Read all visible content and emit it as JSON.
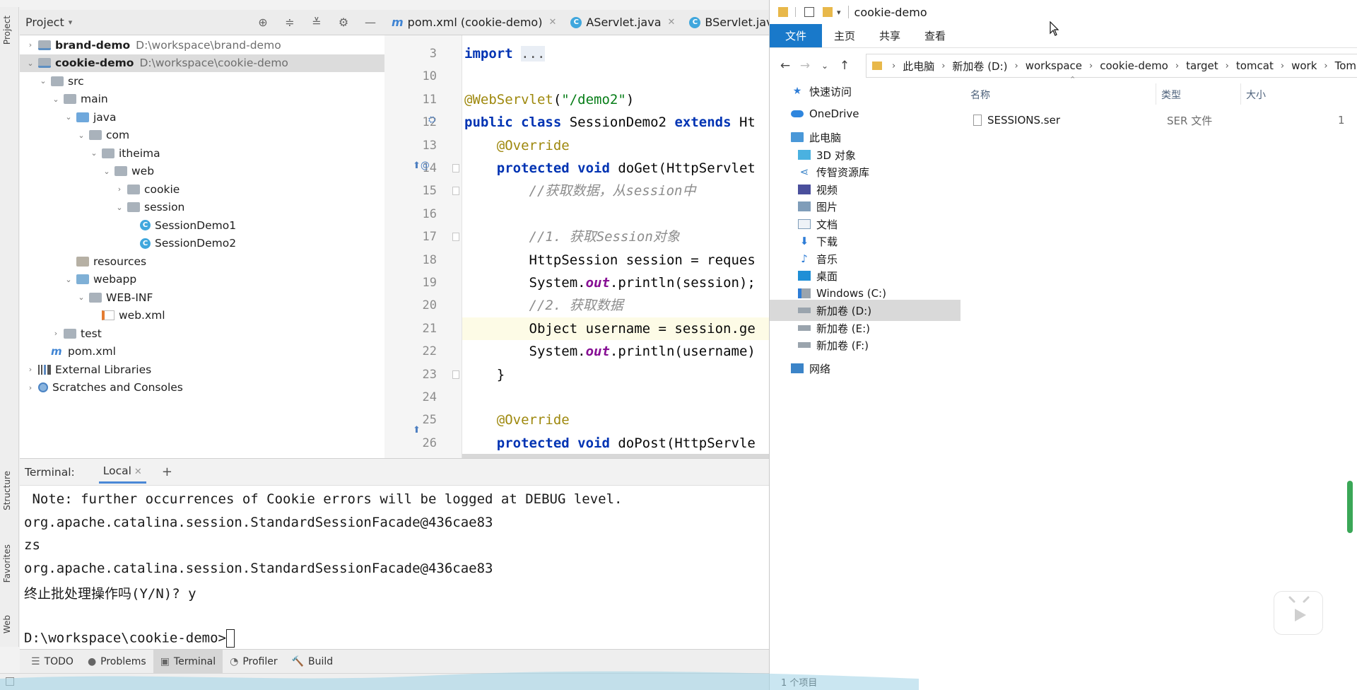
{
  "ide": {
    "side_labels": {
      "project": "Project",
      "structure": "Structure",
      "favorites": "Favorites",
      "web": "Web"
    },
    "project_title": "Project",
    "tree": [
      {
        "label": "brand-demo",
        "path": "D:\\workspace\\brand-demo",
        "bold": true,
        "depth": 0,
        "chevron": "›",
        "icon": "module"
      },
      {
        "label": "cookie-demo",
        "path": "D:\\workspace\\cookie-demo",
        "bold": true,
        "depth": 0,
        "chevron": "⌄",
        "icon": "module",
        "selected": true
      },
      {
        "label": "src",
        "depth": 1,
        "chevron": "⌄",
        "icon": "folder"
      },
      {
        "label": "main",
        "depth": 2,
        "chevron": "⌄",
        "icon": "folder"
      },
      {
        "label": "java",
        "depth": 3,
        "chevron": "⌄",
        "icon": "folder-src"
      },
      {
        "label": "com",
        "depth": 4,
        "chevron": "⌄",
        "icon": "folder"
      },
      {
        "label": "itheima",
        "depth": 5,
        "chevron": "⌄",
        "icon": "folder"
      },
      {
        "label": "web",
        "depth": 6,
        "chevron": "⌄",
        "icon": "folder"
      },
      {
        "label": "cookie",
        "depth": 7,
        "chevron": "›",
        "icon": "folder"
      },
      {
        "label": "session",
        "depth": 7,
        "chevron": "⌄",
        "icon": "folder"
      },
      {
        "label": "SessionDemo1",
        "depth": 8,
        "chevron": "",
        "icon": "cls"
      },
      {
        "label": "SessionDemo2",
        "depth": 8,
        "chevron": "",
        "icon": "cls"
      },
      {
        "label": "resources",
        "depth": 3,
        "chevron": "",
        "icon": "folder-res"
      },
      {
        "label": "webapp",
        "depth": 3,
        "chevron": "⌄",
        "icon": "folder-web"
      },
      {
        "label": "WEB-INF",
        "depth": 4,
        "chevron": "⌄",
        "icon": "folder"
      },
      {
        "label": "web.xml",
        "depth": 5,
        "chevron": "",
        "icon": "xml"
      },
      {
        "label": "test",
        "depth": 2,
        "chevron": "›",
        "icon": "folder"
      },
      {
        "label": "pom.xml",
        "depth": 1,
        "chevron": "",
        "icon": "maven"
      },
      {
        "label": "External Libraries",
        "depth": 0,
        "chevron": "›",
        "icon": "lib"
      },
      {
        "label": "Scratches and Consoles",
        "depth": 0,
        "chevron": "›",
        "icon": "scratch"
      }
    ],
    "editor_tabs": [
      {
        "label": "pom.xml (cookie-demo)",
        "icon": "maven"
      },
      {
        "label": "AServlet.java",
        "icon": "cls"
      },
      {
        "label": "BServlet.java",
        "icon": "cls"
      }
    ],
    "code_lines": [
      {
        "no": "3",
        "html": "<span class=\"kw\">import</span> <span class=\"fold-dots\">...</span>"
      },
      {
        "no": "10",
        "html": ""
      },
      {
        "no": "11",
        "html": "<span class=\"ann\">@WebServlet</span>(<span class=\"str\">\"/demo2\"</span>)"
      },
      {
        "no": "12",
        "html": "<span class=\"kw\">public class</span> SessionDemo2 <span class=\"kw\">extends</span> Ht"
      },
      {
        "no": "13",
        "html": "    <span class=\"ann\">@Override</span>"
      },
      {
        "no": "14",
        "html": "    <span class=\"kw\">protected void</span> doGet(HttpServlet"
      },
      {
        "no": "15",
        "html": "        <span class=\"cmt\">//获取数据，从session中</span>"
      },
      {
        "no": "16",
        "html": ""
      },
      {
        "no": "17",
        "html": "        <span class=\"cmt\">//1. 获取Session对象</span>"
      },
      {
        "no": "18",
        "html": "        HttpSession session = reques"
      },
      {
        "no": "19",
        "html": "        System.<span class=\"fld\">out</span>.println(session);"
      },
      {
        "no": "20",
        "html": "        <span class=\"cmt\">//2. 获取数据</span>"
      },
      {
        "no": "21",
        "html": "        Object username = session.ge",
        "current": true
      },
      {
        "no": "22",
        "html": "        System.<span class=\"fld\">out</span>.println(username)"
      },
      {
        "no": "23",
        "html": "    }"
      },
      {
        "no": "24",
        "html": ""
      },
      {
        "no": "25",
        "html": "    <span class=\"ann\">@Override</span>"
      },
      {
        "no": "26",
        "html": "    <span class=\"kw\">protected void</span> doPost(HttpServle"
      }
    ],
    "terminal": {
      "label": "Terminal:",
      "tab": "Local",
      "lines": [
        " Note: further occurrences of Cookie errors will be logged at DEBUG level.",
        "org.apache.catalina.session.StandardSessionFacade@436cae83",
        "zs",
        "org.apache.catalina.session.StandardSessionFacade@436cae83",
        "终止批处理操作吗(Y/N)? y",
        ""
      ],
      "prompt": "D:\\workspace\\cookie-demo>"
    },
    "bottom_tools": [
      {
        "label": "TODO",
        "icon": "☰"
      },
      {
        "label": "Problems",
        "icon": "●"
      },
      {
        "label": "Terminal",
        "icon": "▣",
        "active": true
      },
      {
        "label": "Profiler",
        "icon": "◔"
      },
      {
        "label": "Build",
        "icon": "🔨"
      }
    ]
  },
  "explorer": {
    "title": "cookie-demo",
    "ribbon_tabs": [
      "文件",
      "主页",
      "共享",
      "查看"
    ],
    "breadcrumb": [
      "此电脑",
      "新加卷 (D:)",
      "workspace",
      "cookie-demo",
      "target",
      "tomcat",
      "work",
      "Tom"
    ],
    "nav": [
      {
        "label": "快速访问",
        "icon": "star"
      },
      {
        "label": "OneDrive",
        "icon": "cloud"
      },
      {
        "label": "此电脑",
        "icon": "pc"
      },
      {
        "label": "3D 对象",
        "icon": "cube"
      },
      {
        "label": "传智资源库",
        "icon": "share"
      },
      {
        "label": "视频",
        "icon": "video"
      },
      {
        "label": "图片",
        "icon": "image"
      },
      {
        "label": "文档",
        "icon": "doc"
      },
      {
        "label": "下载",
        "icon": "download"
      },
      {
        "label": "音乐",
        "icon": "music"
      },
      {
        "label": "桌面",
        "icon": "desktop"
      },
      {
        "label": "Windows (C:)",
        "icon": "drive-win"
      },
      {
        "label": "新加卷 (D:)",
        "icon": "drive",
        "selected": true
      },
      {
        "label": "新加卷 (E:)",
        "icon": "drive"
      },
      {
        "label": "新加卷 (F:)",
        "icon": "drive"
      },
      {
        "label": "网络",
        "icon": "network"
      }
    ],
    "columns": {
      "name": "名称",
      "type": "类型",
      "size": "大小"
    },
    "files": [
      {
        "name": "SESSIONS.ser",
        "type": "SER 文件",
        "size": "1"
      }
    ],
    "status": "1 个项目"
  }
}
